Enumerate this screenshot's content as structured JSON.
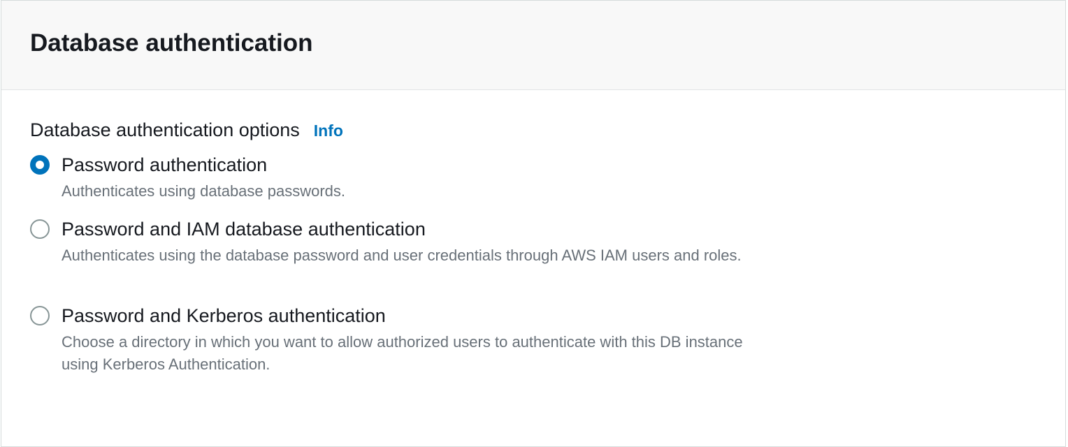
{
  "panel": {
    "title": "Database authentication"
  },
  "field": {
    "label": "Database authentication options",
    "info_link": "Info"
  },
  "options": [
    {
      "label": "Password authentication",
      "description": "Authenticates using database passwords.",
      "selected": true
    },
    {
      "label": "Password and IAM database authentication",
      "description": "Authenticates using the database password and user credentials through AWS IAM users and roles.",
      "selected": false
    },
    {
      "label": "Password and Kerberos authentication",
      "description": "Choose a directory in which you want to allow authorized users to authenticate with this DB instance using Kerberos Authentication.",
      "selected": false
    }
  ],
  "colors": {
    "accent": "#0073bb",
    "header_bg": "#f8f8f8",
    "text_primary": "#16191f",
    "text_secondary": "#687078",
    "radio_border": "#879596"
  }
}
